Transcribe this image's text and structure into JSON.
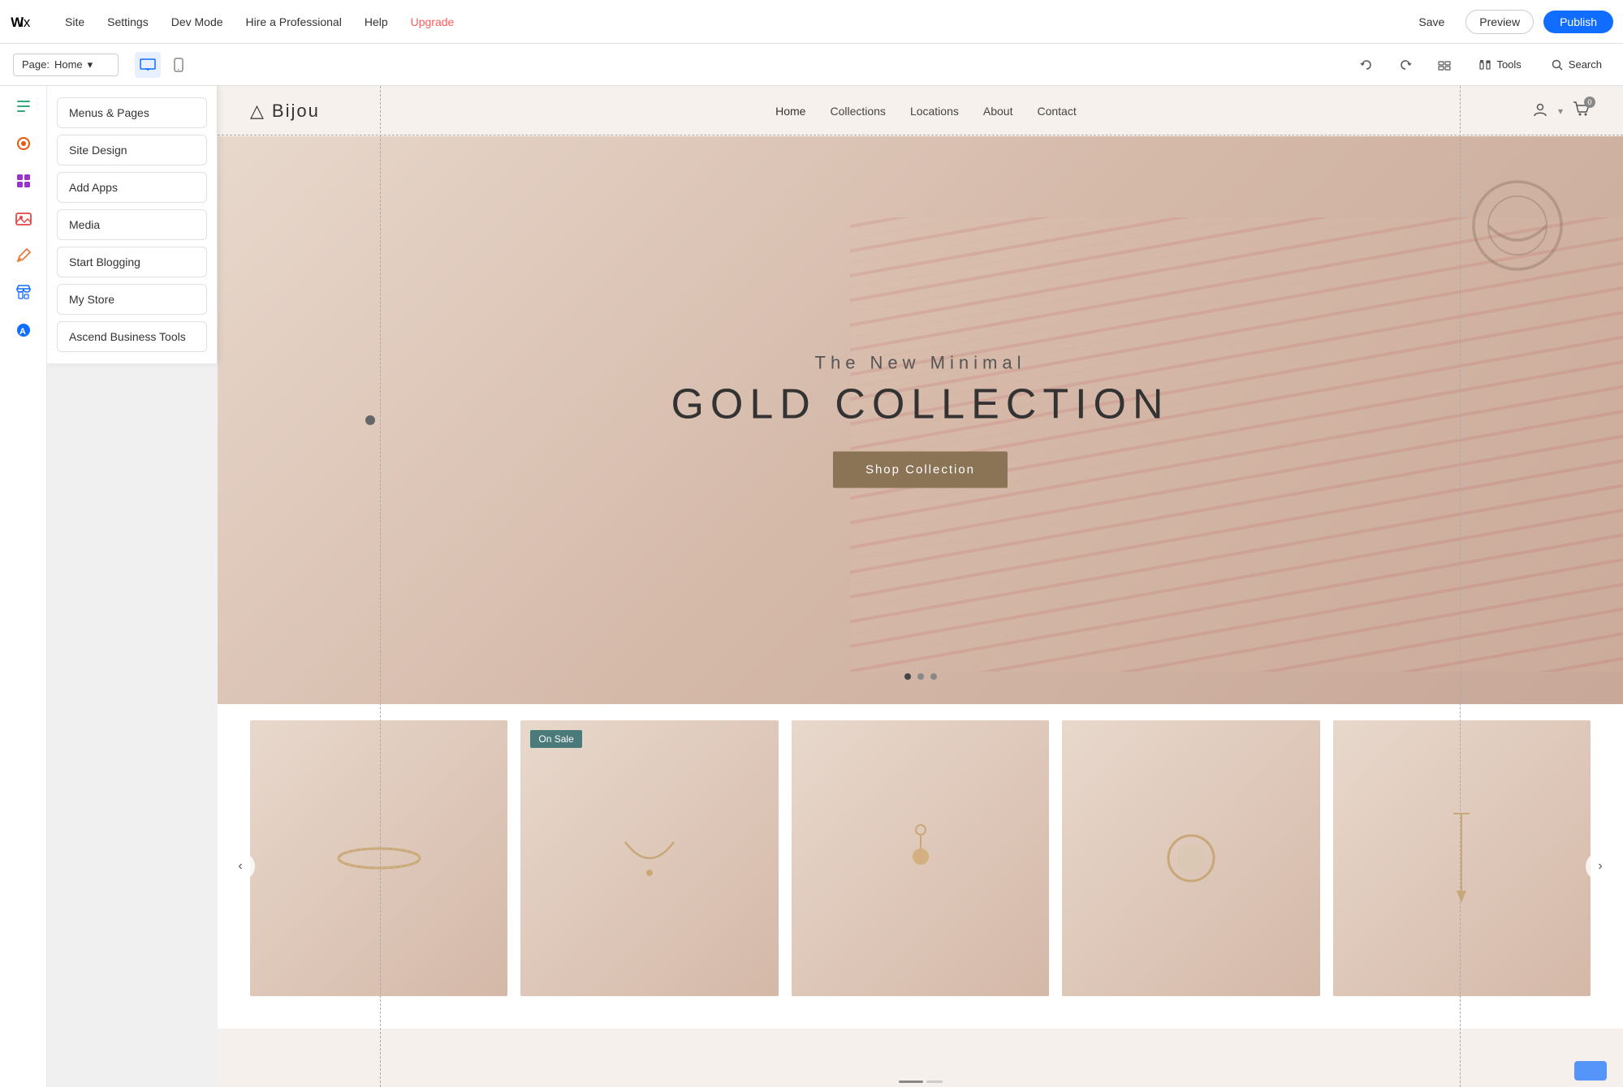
{
  "topbar": {
    "logo": "W",
    "nav": [
      {
        "label": "Site",
        "id": "site"
      },
      {
        "label": "Settings",
        "id": "settings"
      },
      {
        "label": "Dev Mode",
        "id": "dev-mode"
      },
      {
        "label": "Hire a Professional",
        "id": "hire"
      },
      {
        "label": "Help",
        "id": "help"
      },
      {
        "label": "Upgrade",
        "id": "upgrade"
      }
    ],
    "save_label": "Save",
    "preview_label": "Preview",
    "publish_label": "Publish"
  },
  "subbar": {
    "page_label": "Page:",
    "page_name": "Home",
    "desktop_icon": "🖥",
    "mobile_icon": "📱",
    "tools_label": "Tools",
    "search_label": "Search"
  },
  "sidebar": {
    "add_label": "+",
    "icons": [
      {
        "name": "menus-pages-icon",
        "symbol": "☰"
      },
      {
        "name": "site-design-icon",
        "symbol": "🎨"
      },
      {
        "name": "add-apps-icon",
        "symbol": "⊞"
      },
      {
        "name": "media-icon",
        "symbol": "🖼"
      },
      {
        "name": "blog-icon",
        "symbol": "✏"
      },
      {
        "name": "store-icon",
        "symbol": "🛍"
      },
      {
        "name": "ascend-icon",
        "symbol": "🅐"
      }
    ]
  },
  "panel": {
    "buttons": [
      {
        "label": "Menus & Pages",
        "id": "menus-pages"
      },
      {
        "label": "Site Design",
        "id": "site-design"
      },
      {
        "label": "Add Apps",
        "id": "add-apps"
      },
      {
        "label": "Media",
        "id": "media"
      },
      {
        "label": "Start Blogging",
        "id": "start-blogging"
      },
      {
        "label": "My Store",
        "id": "my-store"
      },
      {
        "label": "Ascend Business Tools",
        "id": "ascend-business-tools"
      }
    ]
  },
  "site": {
    "logo_icon": "△",
    "logo_text": "Bijou",
    "nav": [
      {
        "label": "Home",
        "active": true
      },
      {
        "label": "Collections"
      },
      {
        "label": "Locations"
      },
      {
        "label": "About"
      },
      {
        "label": "Contact"
      }
    ],
    "hero": {
      "subtitle": "The New Minimal",
      "title": "GOLD COLLECTION",
      "shop_btn": "Shop Collection"
    },
    "on_sale_label": "On Sale"
  },
  "products": {
    "arrow_left": "‹",
    "arrow_right": "›",
    "carousel_dots": [
      {
        "active": true
      },
      {
        "active": false
      },
      {
        "active": false
      }
    ]
  },
  "colors": {
    "accent_blue": "#116dff",
    "publish_bg": "#116dff",
    "upgrade_color": "#ff5c5c",
    "hero_btn": "#8b7355",
    "on_sale_bg": "#4a7a7a"
  }
}
